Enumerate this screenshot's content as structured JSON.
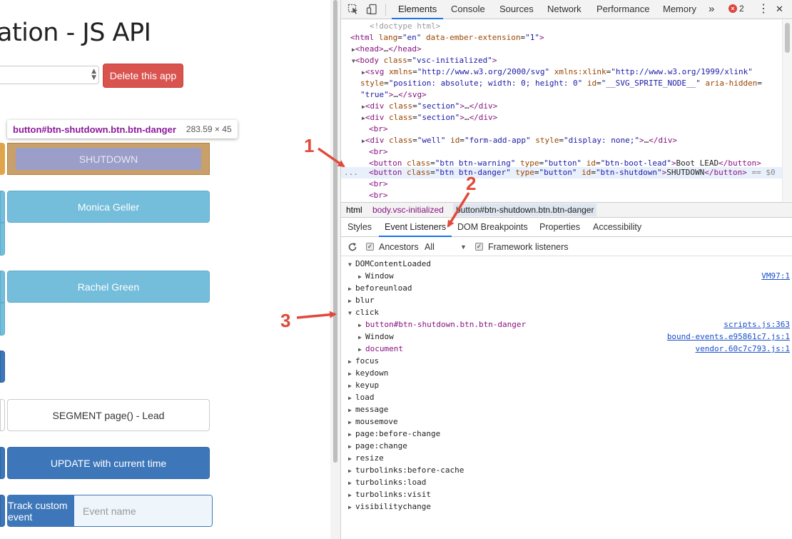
{
  "page": {
    "title_fragment": "ation - JS API",
    "delete_button": "Delete this app",
    "tooltip_selector": "button#btn-shutdown.btn.btn-danger",
    "tooltip_dims": "283.59 × 45",
    "shutdown_label": "SHUTDOWN",
    "monica_button": "Monica Geller",
    "rachel_button": "Rachel Green",
    "segment_button": "SEGMENT page() - Lead",
    "update_button": "UPDATE with current time",
    "track_button": "Track custom event",
    "event_name_placeholder": "Event name"
  },
  "devtools": {
    "tabs": [
      "Elements",
      "Console",
      "Sources",
      "Network",
      "Performance",
      "Memory"
    ],
    "more_tabs": "»",
    "error_count": "2",
    "menu": "⋮",
    "close": "✕",
    "breadcrumbs": [
      "html",
      "body.vsc-initialized",
      "button#btn-shutdown.btn.btn-danger"
    ],
    "subtabs": [
      "Styles",
      "Event Listeners",
      "DOM Breakpoints",
      "Properties",
      "Accessibility"
    ],
    "filter": {
      "ancestors_label": "Ancestors",
      "ancestors_value": "All",
      "framework_label": "Framework listeners"
    },
    "dom_lines": [
      "<!doctype html>",
      "<html lang=\"en\" data-ember-extension=\"1\">",
      "▶<head>…</head>",
      "▼<body class=\"vsc-initialized\">",
      "▶<svg xmlns=\"http://www.w3.org/2000/svg\" xmlns:xlink=\"http://www.w3.org/1999/xlink\"",
      "style=\"position: absolute; width: 0; height: 0\" id=\"__SVG_SPRITE_NODE__\" aria-hidden=",
      "\"true\">…</svg>",
      "▶<div class=\"section\">…</div>",
      "▶<div class=\"section\">…</div>",
      "<br>",
      "▶<div class=\"well\" id=\"form-add-app\" style=\"display: none;\">…</div>",
      "<br>",
      "<button class=\"btn btn-warning\" type=\"button\" id=\"btn-boot-lead\">Boot LEAD</button>",
      "<button class=\"btn btn-danger\" type=\"button\" id=\"btn-shutdown\">SHUTDOWN</button> == $0",
      "<br>",
      "<br>"
    ],
    "selected_row_marker": "...",
    "events": [
      {
        "name": "DOMContentLoaded",
        "expanded": true
      },
      {
        "name": "Window",
        "child": true,
        "src": "VM97:1"
      },
      {
        "name": "beforeunload"
      },
      {
        "name": "blur"
      },
      {
        "name": "click",
        "expanded": true
      },
      {
        "name": "button#btn-shutdown.btn.btn-danger",
        "child": true,
        "src": "scripts.js:363"
      },
      {
        "name": "Window",
        "child": true,
        "src": "bound-events.e95861c7.js:1"
      },
      {
        "name": "document",
        "child": true,
        "src": "vendor.60c7c793.js:1"
      },
      {
        "name": "focus"
      },
      {
        "name": "keydown"
      },
      {
        "name": "keyup"
      },
      {
        "name": "load"
      },
      {
        "name": "message"
      },
      {
        "name": "mousemove"
      },
      {
        "name": "page:before-change"
      },
      {
        "name": "page:change"
      },
      {
        "name": "resize"
      },
      {
        "name": "turbolinks:before-cache"
      },
      {
        "name": "turbolinks:load"
      },
      {
        "name": "turbolinks:visit"
      },
      {
        "name": "visibilitychange"
      }
    ]
  },
  "annotations": [
    "1",
    "2",
    "3"
  ],
  "colors": {
    "danger": "#d9534f",
    "info": "#74bddb",
    "primary": "#3e77b9",
    "annotation": "#e04a3a",
    "devtools_accent": "#1a73e8"
  }
}
